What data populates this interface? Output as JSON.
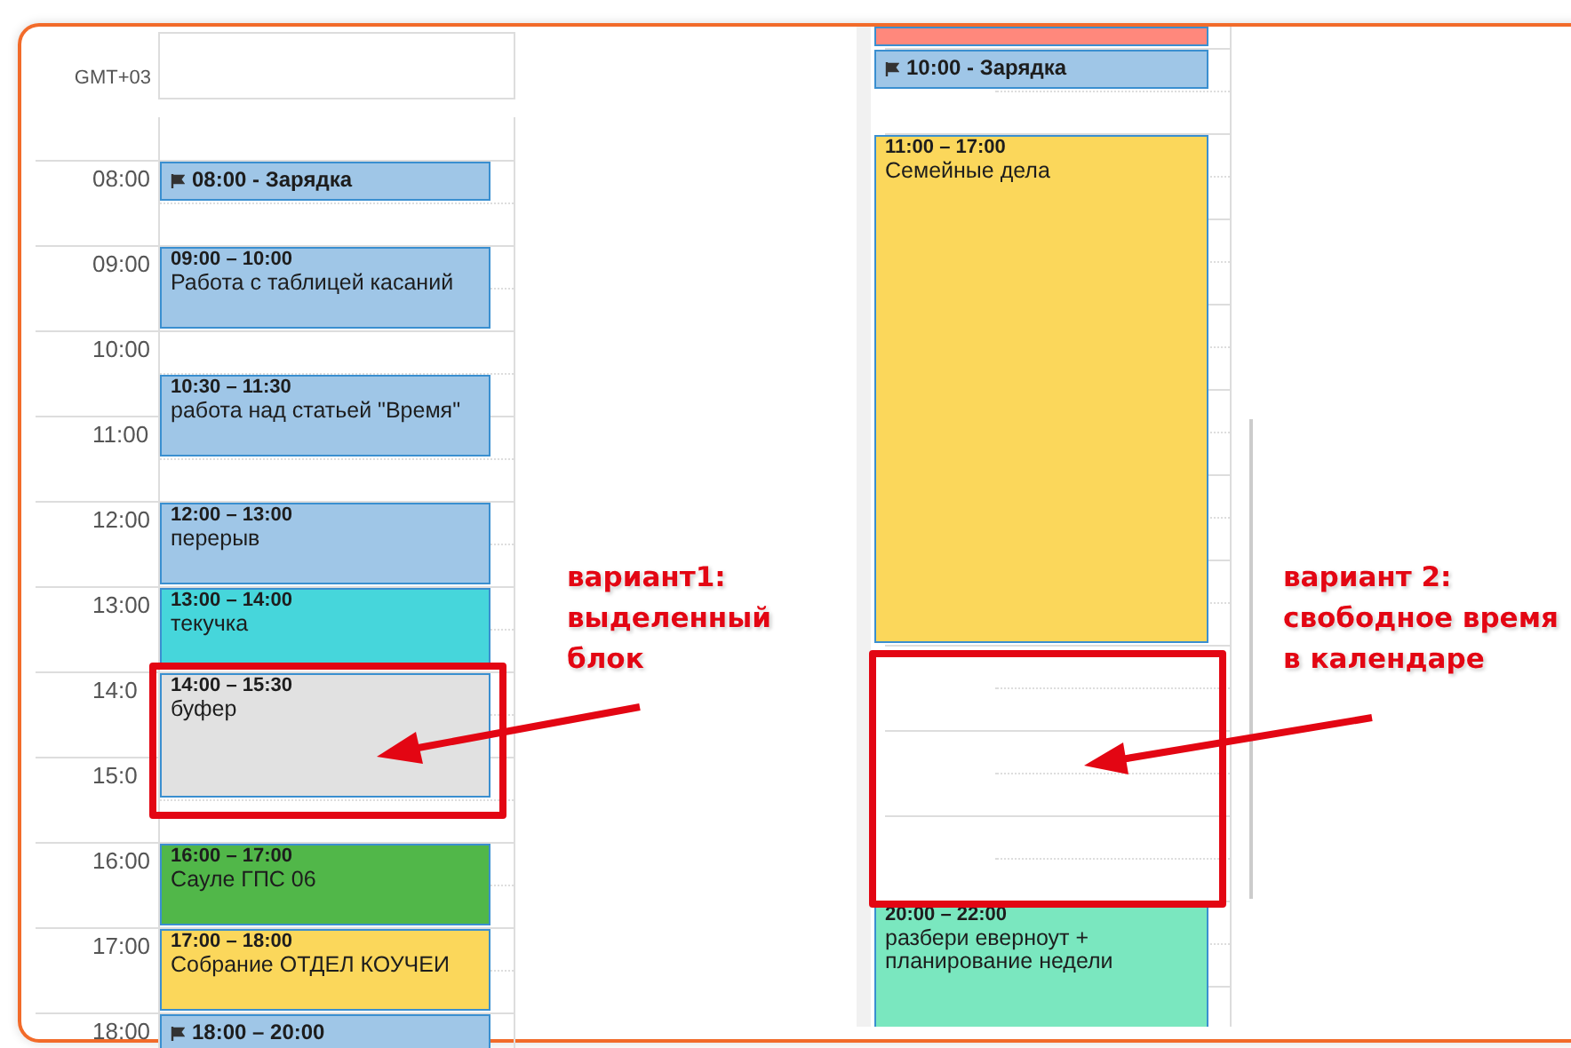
{
  "left_calendar": {
    "timezone": "GMT+03",
    "hours": [
      "08:00",
      "09:00",
      "10:00",
      "11:00",
      "12:00",
      "13:00",
      "14:0",
      "15:0",
      "16:00",
      "17:00",
      "18:00"
    ],
    "events": [
      {
        "kind": "reminder",
        "title": "08:00 - Зарядка",
        "color": "#9fc6e7"
      },
      {
        "kind": "timed",
        "time": "09:00 – 10:00",
        "title": "Работа с таблицей касаний",
        "color": "#9fc6e7"
      },
      {
        "kind": "timed",
        "time": "10:30 – 11:30",
        "title": "работа над статьей \"Время\"",
        "color": "#9fc6e7"
      },
      {
        "kind": "timed",
        "time": "12:00 – 13:00",
        "title": "перерыв",
        "color": "#9fc6e7"
      },
      {
        "kind": "timed",
        "time": "13:00 – 14:00",
        "title": "текучка",
        "color": "#46d6db"
      },
      {
        "kind": "timed",
        "time": "14:00 – 15:30",
        "title": "буфер",
        "color": "#e1e1e1"
      },
      {
        "kind": "timed",
        "time": "16:00 – 17:00",
        "title": "Сауле ГПС 06",
        "color": "#51b749"
      },
      {
        "kind": "timed",
        "time": "17:00 – 18:00",
        "title": "Собрание ОТДЕЛ КОУЧЕИ",
        "color": "#fbd75b"
      },
      {
        "kind": "reminder",
        "title": "18:00 – 20:00",
        "color": "#9fc6e7"
      }
    ]
  },
  "right_calendar": {
    "events": [
      {
        "kind": "cut",
        "color": "#ff887c"
      },
      {
        "kind": "reminder",
        "title": "10:00 - Зарядка",
        "color": "#9fc6e7"
      },
      {
        "kind": "timed",
        "time": "11:00 – 17:00",
        "title": "Семейные дела",
        "color": "#fbd75b"
      },
      {
        "kind": "timed",
        "time": "20:00 – 22:00",
        "title": "разбери еверноут + планирование недели",
        "color": "#7ae7bf"
      }
    ]
  },
  "annotations": [
    {
      "text": "вариант1:\nвыделенный\nблок"
    },
    {
      "text": "вариант 2:\nсвободное время\nв календаре"
    }
  ]
}
